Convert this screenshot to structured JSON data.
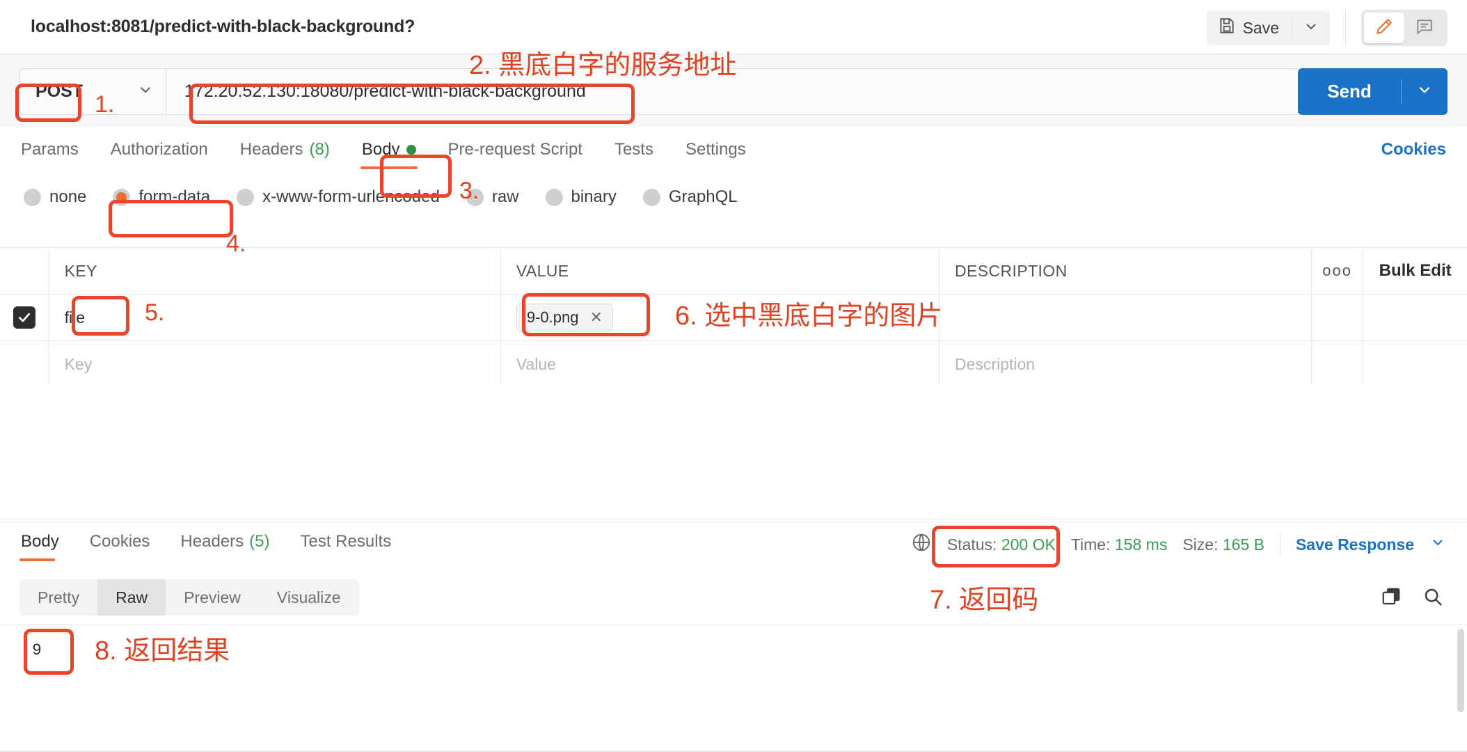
{
  "titlebar": {
    "doc_title": "localhost:8081/predict-with-black-background?",
    "save_label": "Save",
    "save_icon": "floppy-disk-icon",
    "caret_icon": "chevron-down-icon",
    "edit_icon": "pencil-icon",
    "comment_icon": "comment-icon"
  },
  "request": {
    "method": "POST",
    "method_caret": "chevron-down-icon",
    "url": "172.20.52.130:18080/predict-with-black-background",
    "send_label": "Send",
    "send_caret": "chevron-down-icon",
    "tabs": [
      {
        "label": "Params",
        "count": "",
        "active": false
      },
      {
        "label": "Authorization",
        "count": "",
        "active": false
      },
      {
        "label": "Headers",
        "count": "(8)",
        "active": false
      },
      {
        "label": "Body",
        "count": "",
        "active": true
      },
      {
        "label": "Pre-request Script",
        "count": "",
        "active": false
      },
      {
        "label": "Tests",
        "count": "",
        "active": false
      },
      {
        "label": "Settings",
        "count": "",
        "active": false
      }
    ],
    "cookies_link": "Cookies",
    "body_types": [
      {
        "label": "none",
        "selected": false
      },
      {
        "label": "form-data",
        "selected": true
      },
      {
        "label": "x-www-form-urlencoded",
        "selected": false
      },
      {
        "label": "raw",
        "selected": false
      },
      {
        "label": "binary",
        "selected": false
      },
      {
        "label": "GraphQL",
        "selected": false
      }
    ]
  },
  "table": {
    "headers": {
      "key": "KEY",
      "value": "VALUE",
      "description": "DESCRIPTION"
    },
    "more_icon": "ooo",
    "bulk_edit": "Bulk Edit",
    "rows": [
      {
        "checked": true,
        "key": "file",
        "value": "9-0.png",
        "value_is_file": true,
        "description": ""
      }
    ],
    "placeholders": {
      "key": "Key",
      "value": "Value",
      "description": "Description"
    }
  },
  "response": {
    "tabs": [
      {
        "label": "Body",
        "count": "",
        "active": true
      },
      {
        "label": "Cookies",
        "count": "",
        "active": false
      },
      {
        "label": "Headers",
        "count": "(5)",
        "active": false
      },
      {
        "label": "Test Results",
        "count": "",
        "active": false
      }
    ],
    "globe_icon": "globe-icon",
    "status_label": "Status:",
    "status_value": "200 OK",
    "time_label": "Time:",
    "time_value": "158 ms",
    "size_label": "Size:",
    "size_value": "165 B",
    "save_response": "Save Response",
    "save_response_caret": "chevron-down-icon",
    "view_modes": [
      {
        "label": "Pretty",
        "active": false
      },
      {
        "label": "Raw",
        "active": true
      },
      {
        "label": "Preview",
        "active": false
      },
      {
        "label": "Visualize",
        "active": false
      }
    ],
    "copy_icon": "copy-icon",
    "search_icon": "search-icon",
    "body_text": "9"
  },
  "annotations": [
    {
      "id": "a1",
      "text": "1."
    },
    {
      "id": "a2",
      "text": "2. 黑底白字的服务地址"
    },
    {
      "id": "a3",
      "text": "3."
    },
    {
      "id": "a4",
      "text": "4."
    },
    {
      "id": "a5",
      "text": "5."
    },
    {
      "id": "a6",
      "text": "6. 选中黑底白字的图片"
    },
    {
      "id": "a7",
      "text": "7. 返回码"
    },
    {
      "id": "a8",
      "text": "8. 返回结果"
    }
  ],
  "colors": {
    "accent_orange": "#e8703a",
    "annotation_red": "#e8452a",
    "link_blue": "#1a73c7",
    "send_blue": "#1a73c7",
    "success_green": "#3a9e52"
  }
}
